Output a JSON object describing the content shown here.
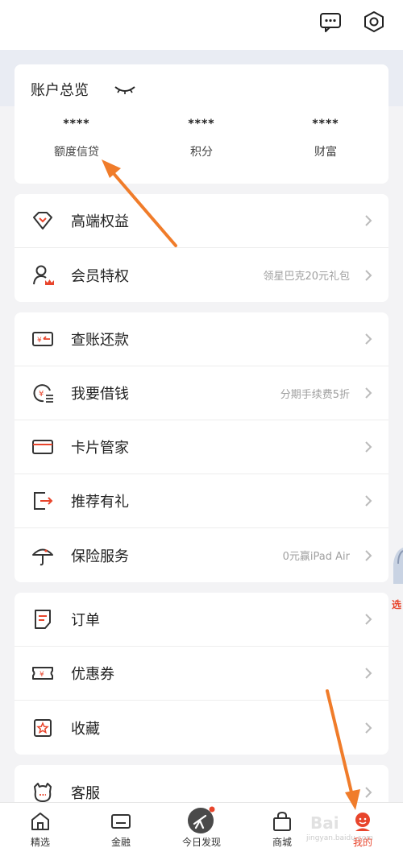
{
  "overview": {
    "title": "账户总览",
    "stats": [
      {
        "value": "****",
        "label": "额度信贷"
      },
      {
        "value": "****",
        "label": "积分"
      },
      {
        "value": "****",
        "label": "财富"
      }
    ]
  },
  "group1": [
    {
      "label": "高端权益",
      "hint": ""
    },
    {
      "label": "会员特权",
      "hint": "领星巴克20元礼包"
    }
  ],
  "group2": [
    {
      "label": "查账还款",
      "hint": ""
    },
    {
      "label": "我要借钱",
      "hint": "分期手续费5折"
    },
    {
      "label": "卡片管家",
      "hint": ""
    },
    {
      "label": "推荐有礼",
      "hint": ""
    },
    {
      "label": "保险服务",
      "hint": "0元赢iPad Air"
    }
  ],
  "group3": [
    {
      "label": "订单",
      "hint": ""
    },
    {
      "label": "优惠券",
      "hint": ""
    },
    {
      "label": "收藏",
      "hint": ""
    }
  ],
  "group4": [
    {
      "label": "客服",
      "hint": ""
    }
  ],
  "tabs": [
    {
      "label": "精选",
      "icon": "home-icon"
    },
    {
      "label": "金融",
      "icon": "card-icon"
    },
    {
      "label": "今日发现",
      "icon": "telescope-icon"
    },
    {
      "label": "商城",
      "icon": "bag-icon"
    },
    {
      "label": "我的",
      "icon": "profile-icon",
      "active": true
    }
  ],
  "watermark": {
    "main": "Bai",
    "sub": "jingyan.baidu.com"
  },
  "side_ad": "选",
  "colors": {
    "accent": "#e8452c",
    "arrow": "#f07c2a",
    "icon": "#333333"
  }
}
